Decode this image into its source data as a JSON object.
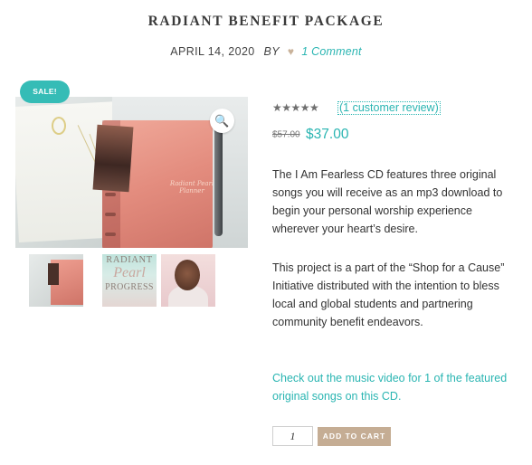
{
  "post": {
    "title": "RADIANT BENEFIT PACKAGE",
    "date": "APRIL 14, 2020",
    "by_label": "BY",
    "comments_link": "1 Comment"
  },
  "gallery": {
    "sale_badge": "SALE!",
    "zoom_icon": "search-icon",
    "thumbnails": [
      {
        "name": "planner-thumbnail"
      },
      {
        "name": "book-cover-thumbnail",
        "text_line1": "RADIANT",
        "text_line2": "Pearl",
        "text_line3": "PROGRESS"
      },
      {
        "name": "portrait-thumbnail"
      }
    ],
    "main_image_cover_text": "Radiant Pearl Planner"
  },
  "product": {
    "rating": 5,
    "stars": "★★★★★",
    "reviews_link": "(1 customer review)",
    "old_price": "$57.00",
    "new_price": "$37.00",
    "description_1": "The I Am Fearless CD features three original songs you will receive as an mp3 download to begin your personal worship experience wherever your heart’s desire.",
    "description_2": "This project is a part of the “Shop for a Cause” Initiative distributed with the intention to bless local and global students and partnering community benefit endeavors.",
    "video_link": "Check out the music video for 1 of the featured original songs on this CD.",
    "quantity": "1",
    "add_to_cart_label": "ADD TO CART"
  },
  "colors": {
    "accent": "#2ab5b2",
    "sale_badge": "#35bcb6",
    "button": "#c5ad94",
    "heart": "#c9b29a"
  }
}
